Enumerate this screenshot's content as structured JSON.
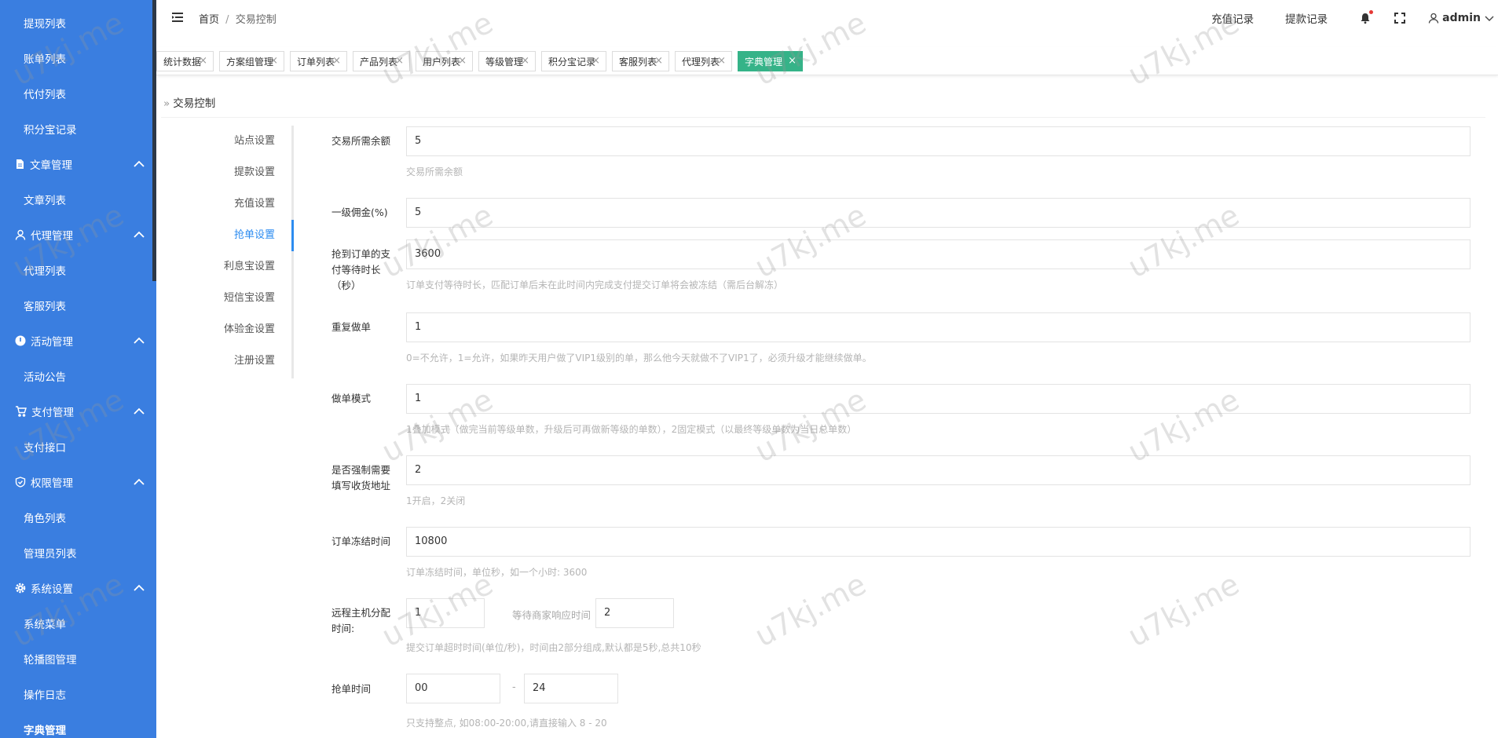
{
  "sidebar": {
    "items": [
      {
        "label": "提现列表",
        "type": "sub"
      },
      {
        "label": "账单列表",
        "type": "sub"
      },
      {
        "label": "代付列表",
        "type": "sub"
      },
      {
        "label": "积分宝记录",
        "type": "sub"
      },
      {
        "label": "文章管理",
        "type": "group",
        "icon": "document-icon"
      },
      {
        "label": "文章列表",
        "type": "sub"
      },
      {
        "label": "代理管理",
        "type": "group",
        "icon": "user-icon"
      },
      {
        "label": "代理列表",
        "type": "sub"
      },
      {
        "label": "客服列表",
        "type": "sub"
      },
      {
        "label": "活动管理",
        "type": "group",
        "icon": "info-icon"
      },
      {
        "label": "活动公告",
        "type": "sub"
      },
      {
        "label": "支付管理",
        "type": "group",
        "icon": "cart-icon"
      },
      {
        "label": "支付接口",
        "type": "sub"
      },
      {
        "label": "权限管理",
        "type": "group",
        "icon": "shield-icon"
      },
      {
        "label": "角色列表",
        "type": "sub"
      },
      {
        "label": "管理员列表",
        "type": "sub"
      },
      {
        "label": "系统设置",
        "type": "group",
        "icon": "gear-icon"
      },
      {
        "label": "系统菜单",
        "type": "sub"
      },
      {
        "label": "轮播图管理",
        "type": "sub"
      },
      {
        "label": "操作日志",
        "type": "sub"
      },
      {
        "label": "字典管理",
        "type": "sub",
        "active": true
      }
    ]
  },
  "header": {
    "breadcrumb_home": "首页",
    "breadcrumb_sep": "/",
    "breadcrumb_current": "交易控制",
    "recharge_link": "充值记录",
    "withdraw_link": "提款记录",
    "user": "admin"
  },
  "tabs": [
    {
      "label": "统计数据"
    },
    {
      "label": "方案组管理"
    },
    {
      "label": "订单列表"
    },
    {
      "label": "产品列表"
    },
    {
      "label": "用户列表"
    },
    {
      "label": "等级管理"
    },
    {
      "label": "积分宝记录"
    },
    {
      "label": "客服列表"
    },
    {
      "label": "代理列表"
    },
    {
      "label": "字典管理",
      "active": true
    }
  ],
  "content": {
    "title": "交易控制",
    "subnav": [
      "站点设置",
      "提款设置",
      "充值设置",
      "抢单设置",
      "利息宝设置",
      "短信宝设置",
      "体验金设置",
      "注册设置"
    ],
    "subnav_active_index": 3,
    "form": {
      "min_balance": {
        "label": "交易所需余额",
        "value": "5",
        "hint": "交易所需余额"
      },
      "commission": {
        "label": "一级佣金(%)",
        "value": "5"
      },
      "pay_wait": {
        "label": "抢到订单的支付等待时长（秒）",
        "value": "3600",
        "hint": "订单支付等待时长，匹配订单后未在此时间内完成支付提交订单将会被冻结（需后台解冻）"
      },
      "repeat": {
        "label": "重复做单",
        "value": "1",
        "hint": "0=不允许，1=允许，如果昨天用户做了VIP1级别的单，那么他今天就做不了VIP1了，必须升级才能继续做单。"
      },
      "mode": {
        "label": "做单模式",
        "value": "1",
        "hint": "1叠加模式（做完当前等级单数，升级后可再做新等级的单数），2固定模式（以最终等级单数为当日总单数）"
      },
      "force_address": {
        "label": "是否强制需要填写收货地址",
        "value": "2",
        "hint": "1开启，2关闭"
      },
      "freeze_time": {
        "label": "订单冻结时间",
        "value": "10800",
        "hint": "订单冻结时间，单位秒，如一个小时: 3600"
      },
      "remote_host": {
        "label": "远程主机分配时间:",
        "value": "1",
        "wait_label": "等待商家响应时间",
        "wait_value": "2",
        "hint": "提交订单超时时间(单位/秒)，时间由2部分组成,默认都是5秒,总共10秒"
      },
      "grab_time": {
        "label": "抢单时间",
        "start": "00",
        "dash": "-",
        "end": "24",
        "hint": "只支持整点, 如08:00-20:00,请直接输入 8 - 20"
      }
    }
  },
  "watermark": "u7kj.me",
  "colors": {
    "sidebar_bg": "#3a7ee0",
    "active_tab": "#35b388",
    "accent": "#2d8cf0",
    "notify_dot": "#e53935"
  }
}
